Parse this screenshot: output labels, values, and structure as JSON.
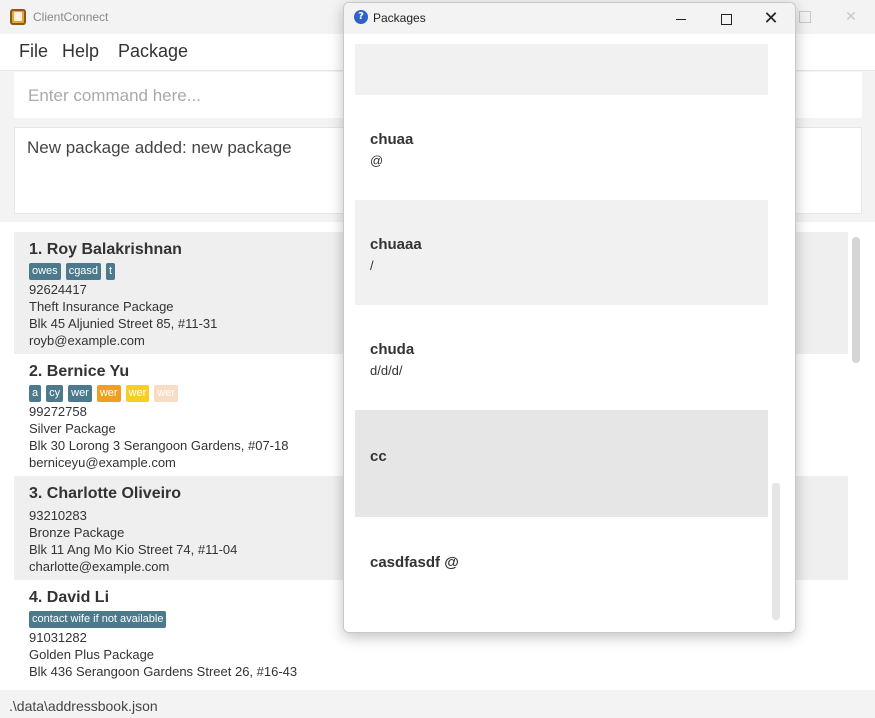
{
  "main_window": {
    "title": "ClientConnect",
    "menu": [
      "File",
      "Help",
      "Package"
    ],
    "command_placeholder": "Enter command here...",
    "result_message": "New package added: new package",
    "status_path": ".\\data\\addressbook.json"
  },
  "persons": [
    {
      "name": "1.  Roy Balakrishnan",
      "tags": [
        {
          "label": "owes",
          "color": "#4a7a8c"
        },
        {
          "label": "cgasd",
          "color": "#4a7a8c"
        },
        {
          "label": "t",
          "color": "#4a7a8c"
        }
      ],
      "phone": "92624417",
      "package": "Theft Insurance Package",
      "address": "Blk 45 Aljunied Street 85, #11-31",
      "email": "royb@example.com"
    },
    {
      "name": "2.  Bernice Yu",
      "tags": [
        {
          "label": "a",
          "color": "#4a7a8c"
        },
        {
          "label": "cy",
          "color": "#4a7a8c"
        },
        {
          "label": "wer",
          "color": "#4a7a8c"
        },
        {
          "label": "wer",
          "color": "#f0a020"
        },
        {
          "label": "wer",
          "color": "#f5cf22"
        },
        {
          "label": "wer",
          "color": "#f8dcc4"
        }
      ],
      "phone": "99272758",
      "package": "Silver Package",
      "address": "Blk 30 Lorong 3 Serangoon Gardens, #07-18",
      "email": "berniceyu@example.com"
    },
    {
      "name": "3.  Charlotte Oliveiro",
      "tags": [],
      "phone": "93210283",
      "package": "Bronze Package",
      "address": "Blk 11 Ang Mo Kio Street 74, #11-04",
      "email": "charlotte@example.com"
    },
    {
      "name": "4.  David Li",
      "tags": [
        {
          "label": "contact wife if not available",
          "color": "#4a7a8c"
        }
      ],
      "phone": "91031282",
      "package": "Golden Plus Package",
      "address": "Blk 436 Serangoon Gardens Street 26, #16-43",
      "email": ""
    }
  ],
  "packages_window": {
    "title": "Packages",
    "icon": "help-question-icon",
    "packages": [
      {
        "name": "chuaa",
        "description": "@"
      },
      {
        "name": "chuaaa",
        "description": "/"
      },
      {
        "name": "chuda",
        "description": "d/d/d/"
      },
      {
        "name": "cc",
        "description": ""
      },
      {
        "name": "casdfasdf @",
        "description": ""
      }
    ]
  }
}
